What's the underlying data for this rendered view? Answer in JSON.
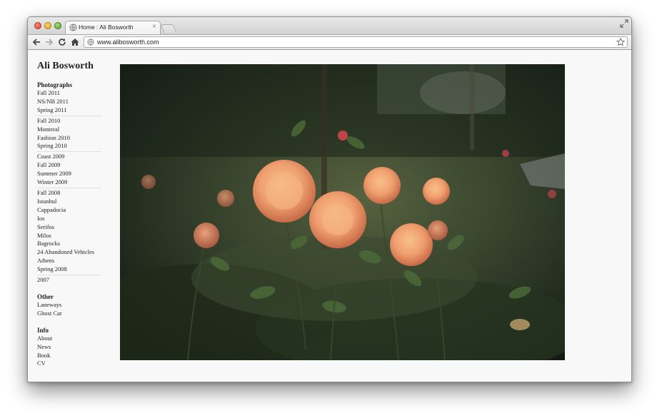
{
  "browser": {
    "tab_title": "Home : Ali Bosworth",
    "tab_close": "×",
    "url": "www.alibosworth.com"
  },
  "site": {
    "title": "Ali Bosworth"
  },
  "nav": {
    "photographs_heading": "Photographs",
    "photographs_groups": [
      [
        "Fall 2011",
        "NS/NB 2011",
        "Spring 2011"
      ],
      [
        "Fall 2010",
        "Montreal",
        "Fashion 2010",
        "Spring 2010"
      ],
      [
        "Coast 2009",
        "Fall 2009",
        "Summer 2009",
        "Winter 2009"
      ],
      [
        "Fall 2008",
        "Istanbul",
        "Cappadocia",
        "Ios",
        "Serifos",
        "Milos",
        "Bagrocks",
        "24 Abandoned Vehicles",
        "Athens",
        "Spring 2008"
      ],
      [
        "2007"
      ]
    ],
    "other_heading": "Other",
    "other_items": [
      "Laneways",
      "Ghost Car"
    ],
    "info_heading": "Info",
    "info_items": [
      "About",
      "News",
      "Book",
      "CV"
    ]
  },
  "icons": {
    "favicon": "globe-icon",
    "back": "back-arrow-icon",
    "forward": "forward-arrow-icon",
    "reload": "reload-icon",
    "home": "home-icon",
    "bookmark": "star-icon",
    "fullscreen": "fullscreen-icon"
  }
}
